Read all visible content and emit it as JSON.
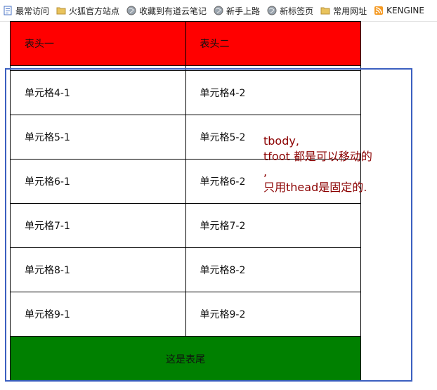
{
  "bookmarks": [
    {
      "label": "最常访问",
      "icon": "page-icon",
      "color": "#4a73c5"
    },
    {
      "label": "火狐官方站点",
      "icon": "folder-icon",
      "color": "#e9c35c"
    },
    {
      "label": "收藏到有道云笔记",
      "icon": "globe-icon",
      "color": "#777777"
    },
    {
      "label": "新手上路",
      "icon": "globe-icon",
      "color": "#777777"
    },
    {
      "label": "新标签页",
      "icon": "globe-icon",
      "color": "#777777"
    },
    {
      "label": "常用网址",
      "icon": "folder-icon",
      "color": "#e9c35c"
    },
    {
      "label": "KENGINE",
      "icon": "rss-icon",
      "color": "#f59a23"
    }
  ],
  "table": {
    "header": [
      "表头一",
      "表头二"
    ],
    "rows": [
      [
        "单元格4-1",
        "单元格4-2"
      ],
      [
        "单元格5-1",
        "单元格5-2"
      ],
      [
        "单元格6-1",
        "单元格6-2"
      ],
      [
        "单元格7-1",
        "单元格7-2"
      ],
      [
        "单元格8-1",
        "单元格8-2"
      ],
      [
        "单元格9-1",
        "单元格9-2"
      ]
    ],
    "footer": "这是表尾",
    "header_bg": "#ff0000",
    "footer_bg": "#008000"
  },
  "note": {
    "line1": "tbody,",
    "line2": "tfoot 都是可以移动的",
    "line3": ",",
    "line4": "只用thead是固定的.",
    "color": "#8b0000"
  },
  "overlay": {
    "border_color": "#3b5fc0"
  }
}
